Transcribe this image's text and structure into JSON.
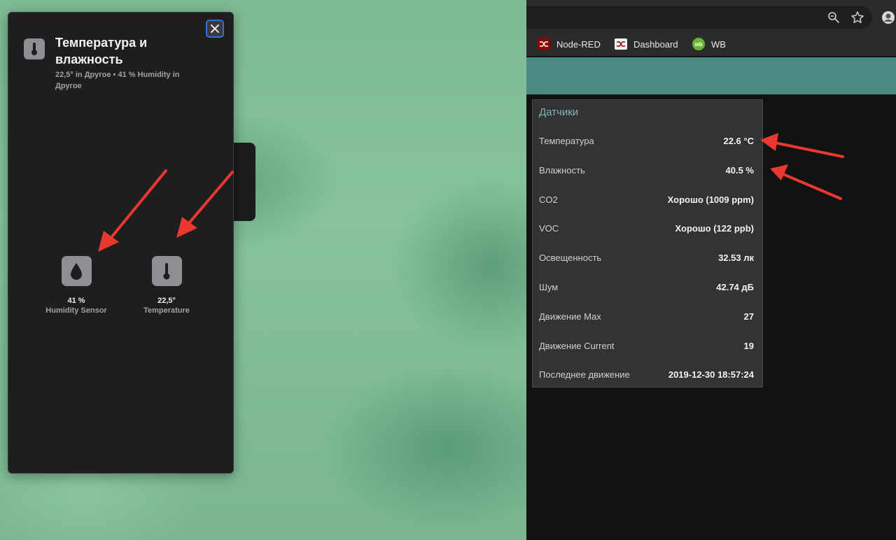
{
  "home_panel": {
    "title": "Температура и влажность",
    "subtitle": "22,5° in Другое • 41 % Humidity in Другое",
    "tiles": [
      {
        "value": "41 %",
        "label": "Humidity Sensor",
        "icon": "water-drop-icon"
      },
      {
        "value": "22,5°",
        "label": "Temperature",
        "icon": "thermometer-icon"
      }
    ]
  },
  "browser": {
    "bookmarks": [
      {
        "label": "Node-RED",
        "icon": "node-red-icon",
        "color": "#8f0000"
      },
      {
        "label": "Dashboard",
        "icon": "dashboard-icon",
        "color": "#8f0000"
      },
      {
        "label": "WB",
        "icon": "wb-icon",
        "color": "#6ab533"
      }
    ],
    "wb_badge": "wb",
    "card": {
      "title": "Датчики",
      "rows": [
        {
          "label": "Температура",
          "value": "22.6 °C"
        },
        {
          "label": "Влажность",
          "value": "40.5 %"
        },
        {
          "label": "CO2",
          "value": "Хорошо (1009 ppm)"
        },
        {
          "label": "VOC",
          "value": "Хорошо (122 ppb)"
        },
        {
          "label": "Освещенность",
          "value": "32.53 лк"
        },
        {
          "label": "Шум",
          "value": "42.74 дБ"
        },
        {
          "label": "Движение Max",
          "value": "27"
        },
        {
          "label": "Движение Current",
          "value": "19"
        },
        {
          "label": "Последнее движение",
          "value": "2019-12-30 18:57:24"
        }
      ]
    }
  },
  "colors": {
    "accent_teal": "#4a8a80",
    "arrow_red": "#e8382f",
    "focus_blue": "#2f6fd6"
  }
}
